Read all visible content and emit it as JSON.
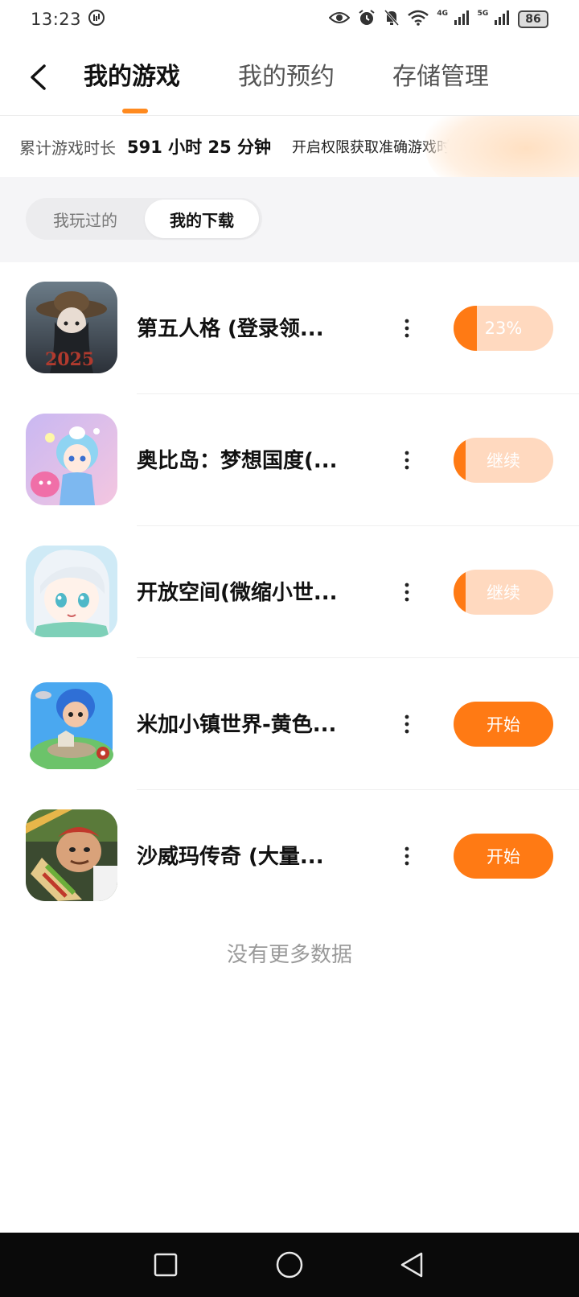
{
  "status_bar": {
    "time": "13:23",
    "network_1": "4G",
    "network_2": "5G",
    "battery": "86"
  },
  "nav": {
    "tabs": [
      {
        "label": "我的游戏",
        "active": true
      },
      {
        "label": "我的预约",
        "active": false
      },
      {
        "label": "存储管理",
        "active": false
      }
    ],
    "accent_color": "#ff8a1f"
  },
  "playtime": {
    "label": "累计游戏时长",
    "value": "591 小时 25 分钟",
    "permission_link": "开启权限获取准确游戏时长记录"
  },
  "filter": {
    "played_label": "我玩过的",
    "downloads_label": "我的下载",
    "selected": "我的下载"
  },
  "games": [
    {
      "name": "第五人格 (登录领...",
      "action": "23%",
      "action_type": "progress",
      "progress": 0.23
    },
    {
      "name": "奥比岛：梦想国度(...",
      "action": "继续",
      "action_type": "progress",
      "progress": 0.12
    },
    {
      "name": "开放空间(微缩小世...",
      "action": "继续",
      "action_type": "progress",
      "progress": 0.12
    },
    {
      "name": "米加小镇世界-黄色...",
      "action": "开始",
      "action_type": "start",
      "progress": 1
    },
    {
      "name": "沙威玛传奇 (大量...",
      "action": "开始",
      "action_type": "start",
      "progress": 1
    }
  ],
  "footer": {
    "no_more": "没有更多数据"
  },
  "colors": {
    "primary_orange": "#ff7a14",
    "progress_bg": "#ffd9bf"
  }
}
